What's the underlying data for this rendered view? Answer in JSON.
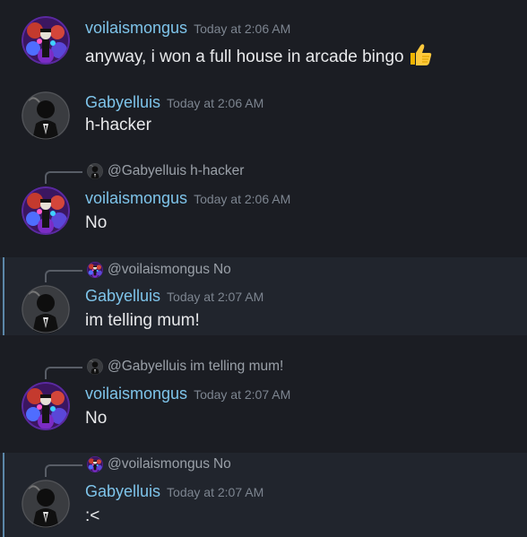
{
  "messages": [
    {
      "author": "voilaismongus",
      "timestamp": "Today at 2:06 AM",
      "text": "anyway, i won a full house in arcade bingo",
      "emoji": "thumbs-up"
    },
    {
      "author": "Gabyelluis",
      "timestamp": "Today at 2:06 AM",
      "text": "h-hacker"
    },
    {
      "reply": {
        "mention": "@Gabyelluis",
        "text": "h-hacker"
      },
      "author": "voilaismongus",
      "timestamp": "Today at 2:06 AM",
      "text": "No"
    },
    {
      "reply": {
        "mention": "@voilaismongus",
        "text": "No"
      },
      "author": "Gabyelluis",
      "timestamp": "Today at 2:07 AM",
      "text": "im telling mum!"
    },
    {
      "reply": {
        "mention": "@Gabyelluis",
        "text": "im telling mum!"
      },
      "author": "voilaismongus",
      "timestamp": "Today at 2:07 AM",
      "text": "No"
    },
    {
      "reply": {
        "mention": "@voilaismongus",
        "text": "No"
      },
      "author": "Gabyelluis",
      "timestamp": "Today at 2:07 AM",
      "text": ":<"
    }
  ],
  "colors": {
    "background": "#1b1d23",
    "highlight_background": "#21252d",
    "highlight_bar": "#5b86a8",
    "username": "#7ec4ea",
    "timestamp": "#7d8590",
    "message_text": "#e8e9eb"
  }
}
